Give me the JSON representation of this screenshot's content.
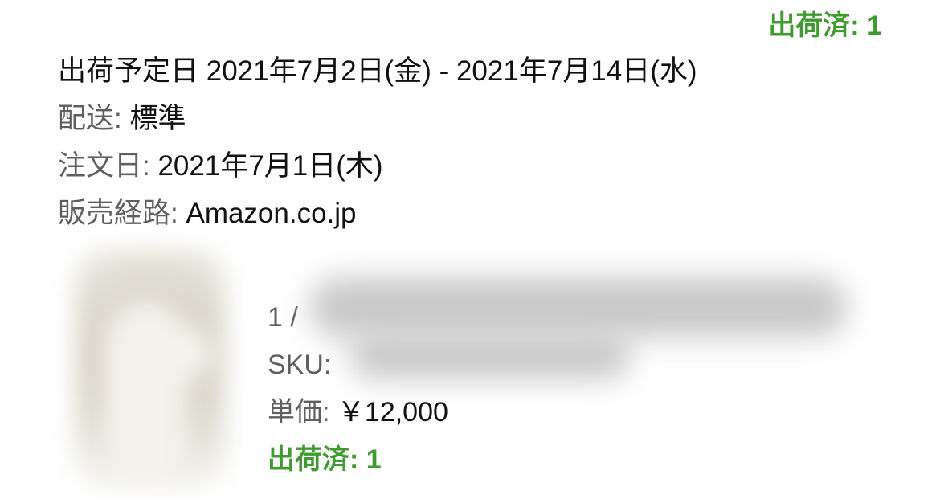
{
  "header": {
    "shipped_status": "出荷済: 1"
  },
  "order": {
    "ship_date_label": "出荷予定日",
    "ship_date_value": "2021年7月2日(金) - 2021年7月14日(水)",
    "shipping_label": "配送:",
    "shipping_value": "標準",
    "order_date_label": "注文日:",
    "order_date_value": "2021年7月1日(木)",
    "channel_label": "販売経路:",
    "channel_value": "Amazon.co.jp"
  },
  "item": {
    "quantity_prefix": "1 /",
    "sku_label": "SKU:",
    "price_label": "単価:",
    "price_value": "￥12,000",
    "shipped_status": "出荷済: 1"
  },
  "colors": {
    "status_green": "#3f9a2f",
    "label_gray": "#5f5f5f",
    "text_dark": "#111111"
  }
}
